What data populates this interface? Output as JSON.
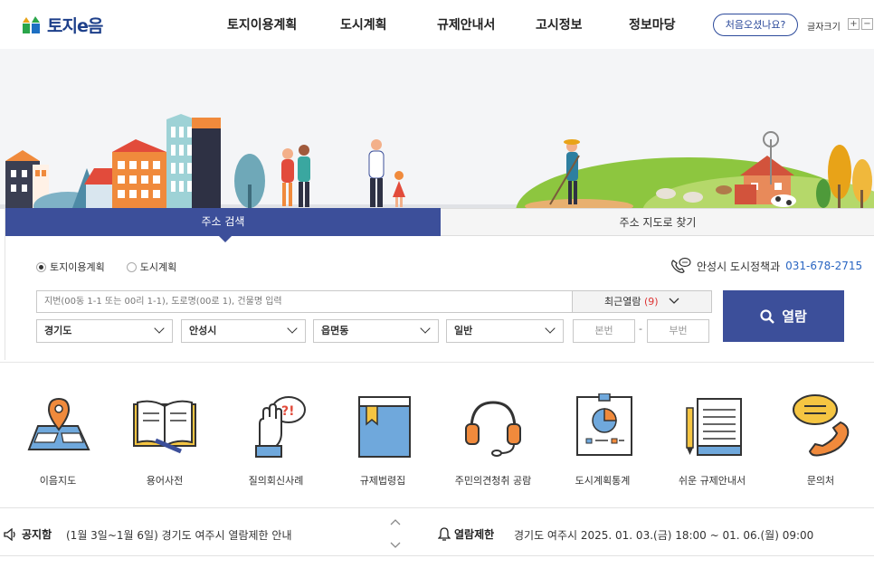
{
  "header": {
    "logo_text": "토지e음",
    "nav": [
      "토지이용계획",
      "도시계획",
      "규제안내서",
      "고시정보",
      "정보마당"
    ],
    "first_visit_button": "처음오셨나요?",
    "font_size_label": "글자크기",
    "font_plus": "+",
    "font_minus": "−"
  },
  "search": {
    "tabs": [
      "주소 검색",
      "주소 지도로 찾기"
    ],
    "radio_options": [
      "토지이용계획",
      "도시계획"
    ],
    "selected_radio": "토지이용계획",
    "contact_label": "안성시 도시정책과",
    "contact_phone": "031-678-2715",
    "input_placeholder": "지번(00동 1-1 또는 00리 1-1), 도로명(00로 1), 건물명 입력",
    "recent_label": "최근열람",
    "recent_count": "(9)",
    "view_button": "열람",
    "selects": [
      "경기도",
      "안성시",
      "읍면동",
      "일반"
    ],
    "bonbeon_placeholder": "본번",
    "bubeon_placeholder": "부번",
    "dash": "-"
  },
  "quick_links": [
    {
      "label": "이음지도",
      "icon": "map-pin-icon"
    },
    {
      "label": "용어사전",
      "icon": "book-icon"
    },
    {
      "label": "질의회신사례",
      "icon": "hand-question-icon"
    },
    {
      "label": "규제법령집",
      "icon": "law-book-icon"
    },
    {
      "label": "주민의견청취 공람",
      "icon": "headset-icon"
    },
    {
      "label": "도시계획통계",
      "icon": "statistics-board-icon"
    },
    {
      "label": "쉬운 규제안내서",
      "icon": "document-pencil-icon"
    },
    {
      "label": "문의처",
      "icon": "phone-chat-icon"
    }
  ],
  "notice": {
    "title": "공지함",
    "text": "(1월 3일~1월 6일) 경기도 여주시 열람제한 안내",
    "restrict_title": "열람제한",
    "restrict_text": "경기도 여주시 2025. 01. 03.(금) 18:00 ~ 01. 06.(월) 09:00"
  },
  "colors": {
    "primary": "#3c4f9a",
    "accent_phone": "#2a66c2",
    "recent_count": "#dd3333"
  }
}
